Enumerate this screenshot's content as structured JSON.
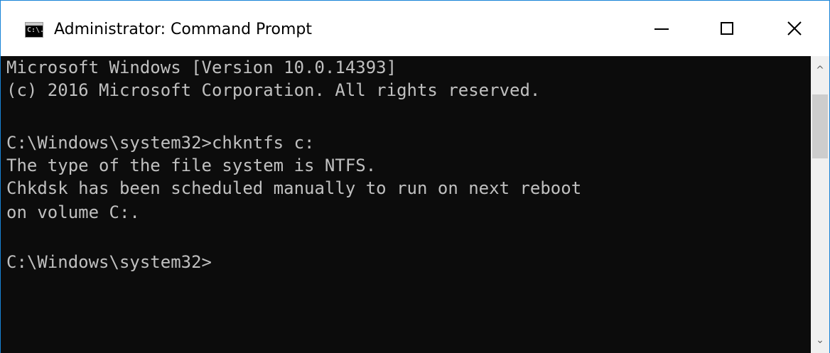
{
  "window": {
    "title": "Administrator: Command Prompt",
    "icon_glyph": "C:\\.",
    "icon": "cmd-icon",
    "controls": {
      "minimize": "minimize-icon",
      "maximize": "maximize-icon",
      "close": "close-icon",
      "close_glyph": "✕"
    }
  },
  "console": {
    "lines": [
      "Microsoft Windows [Version 10.0.14393]",
      "(c) 2016 Microsoft Corporation. All rights reserved.",
      "",
      "C:\\Windows\\system32>chkntfs c:",
      "The type of the file system is NTFS.",
      "Chkdsk has been scheduled manually to run on next reboot",
      "on volume C:.",
      "",
      "C:\\Windows\\system32>"
    ]
  },
  "scrollbar": {
    "up_glyph": "^",
    "down_glyph": "⌄"
  },
  "colors": {
    "console_bg": "#0c0c0c",
    "console_text": "#c0c0c0",
    "titlebar_bg": "#ffffff",
    "border_accent": "#1883d7"
  }
}
